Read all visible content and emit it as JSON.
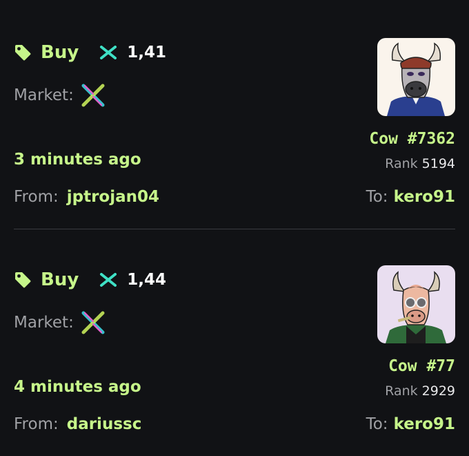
{
  "colors": {
    "background": "#111215",
    "accent": "#c6f58a",
    "muted": "#a0a1a5",
    "divider": "#3a3c40"
  },
  "sales": [
    {
      "type_label": "Buy",
      "type_icon": "tag-icon",
      "currency_icon": "x-token-icon",
      "price": "1,41",
      "market_label": "Market:",
      "market_icon": "x-marketplace-logo-icon",
      "time": "3 minutes ago",
      "from_label": "From:",
      "from": "jptrojan04",
      "nft_name": "Cow #7362",
      "rank_label": "Rank",
      "rank": "5194",
      "to_label": "To:",
      "to": "kero91"
    },
    {
      "type_label": "Buy",
      "type_icon": "tag-icon",
      "currency_icon": "x-token-icon",
      "price": "1,44",
      "market_label": "Market:",
      "market_icon": "x-marketplace-logo-icon",
      "time": "4 minutes ago",
      "from_label": "From:",
      "from": "dariussc",
      "nft_name": "Cow #77",
      "rank_label": "Rank",
      "rank": "2929",
      "to_label": "To:",
      "to": "kero91"
    }
  ]
}
